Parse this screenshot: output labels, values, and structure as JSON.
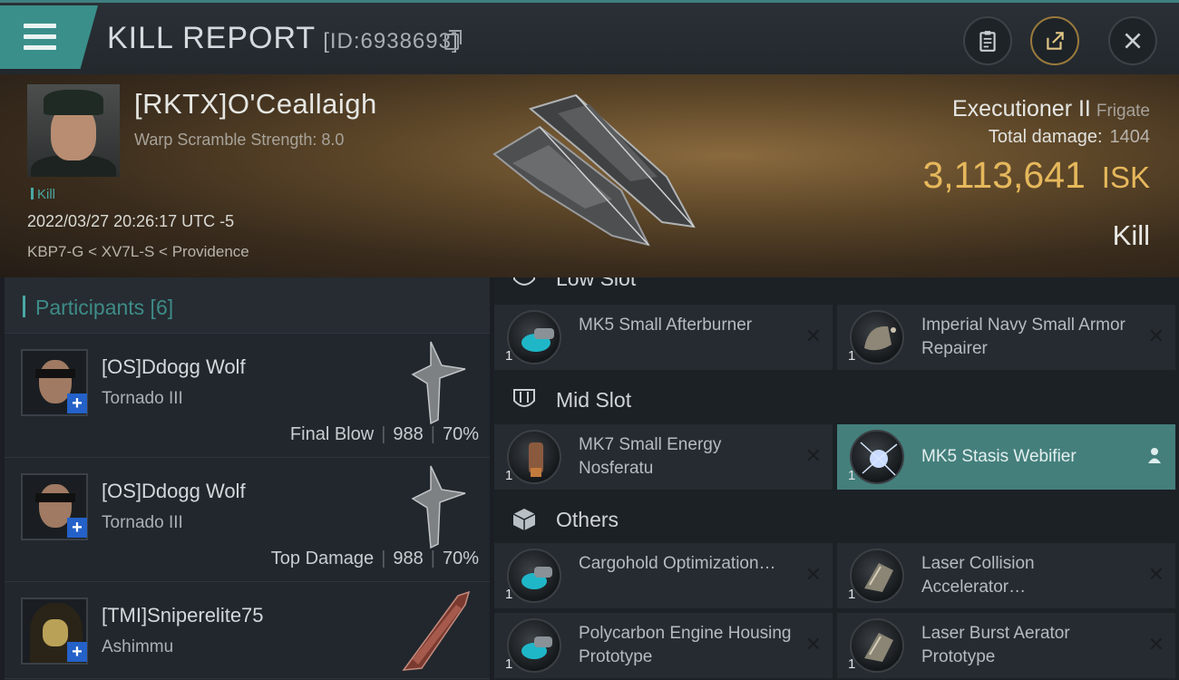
{
  "header": {
    "title": "KILL REPORT",
    "id_label": "[ID:6938693]",
    "menu_icon": "hamburger-menu-icon",
    "buttons": [
      {
        "name": "clipboard-icon"
      },
      {
        "name": "share-icon"
      },
      {
        "name": "close-icon"
      }
    ]
  },
  "victim": {
    "pilot": "[RKTX]O'Ceallaigh",
    "warp_scramble": "Warp Scramble Strength: 8.0",
    "tag": "Kill",
    "datetime": "2022/03/27 20:26:17 UTC -5",
    "location": "KBP7-G < XV7L-S < Providence",
    "ship": "Executioner II",
    "ship_class": "Frigate",
    "total_damage_label": "Total damage:",
    "total_damage_value": "1404",
    "isk_value": "3,113,641",
    "isk_unit": "ISK",
    "result": "Kill"
  },
  "participants": {
    "header": "Participants [6]",
    "rows": [
      {
        "name": "[OS]Ddogg Wolf",
        "ship": "Tornado III",
        "role": "Final Blow",
        "damage": "988",
        "percent": "70%"
      },
      {
        "name": "[OS]Ddogg Wolf",
        "ship": "Tornado III",
        "role": "Top Damage",
        "damage": "988",
        "percent": "70%"
      },
      {
        "name": "[TMI]Sniperelite75",
        "ship": "Ashimmu"
      }
    ]
  },
  "fitting": {
    "low_slot_label": "Low Slot",
    "mid_slot_label": "Mid Slot",
    "others_label": "Others",
    "low": [
      {
        "qty": "1",
        "name": "MK5 Small Afterburner"
      },
      {
        "qty": "1",
        "name": "Imperial Navy Small Armor Repairer"
      }
    ],
    "mid": [
      {
        "qty": "1",
        "name": "MK7 Small Energy Nosferatu"
      },
      {
        "qty": "1",
        "name": "MK5 Stasis Webifier"
      }
    ],
    "others": [
      {
        "qty": "1",
        "name": "Cargohold Optimization…"
      },
      {
        "qty": "1",
        "name": "Laser Collision Accelerator…"
      },
      {
        "qty": "1",
        "name": "Polycarbon Engine Housing Prototype"
      },
      {
        "qty": "1",
        "name": "Laser Burst Aerator Prototype"
      }
    ]
  },
  "colors": {
    "accent": "#4aa7a3",
    "isk": "#e6b85c",
    "highlight_slot": "#447f7c"
  }
}
